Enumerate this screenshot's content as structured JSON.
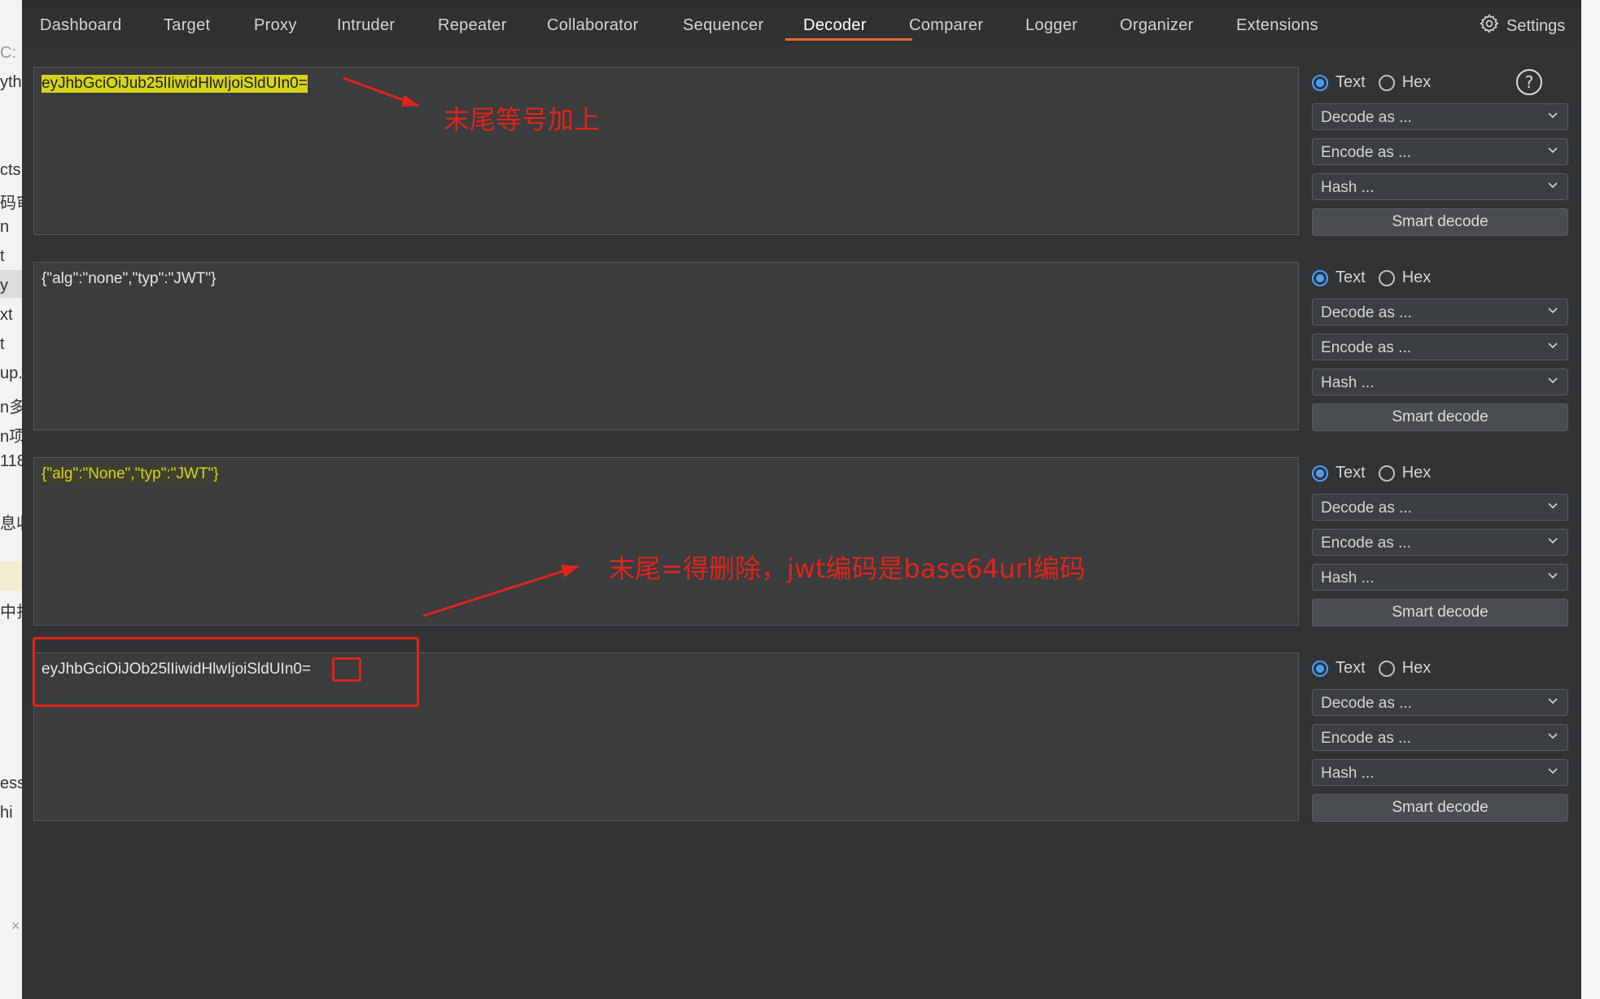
{
  "left_strip": {
    "fragments": [
      "C:",
      "ythe",
      "cts",
      "码审",
      "n",
      "t",
      "y",
      "xt",
      "t",
      "up.",
      "n多",
      "n项",
      "118",
      "息收",
      "中打",
      "ess",
      "hi",
      "×"
    ]
  },
  "tabs": [
    "Dashboard",
    "Target",
    "Proxy",
    "Intruder",
    "Repeater",
    "Collaborator",
    "Sequencer",
    "Decoder",
    "Comparer",
    "Logger",
    "Organizer",
    "Extensions"
  ],
  "active_tab": "Decoder",
  "settings_label": "Settings",
  "panels": [
    {
      "text": "eyJhbGciOiJub25lIiwidHlwIjoiSldUIn0=",
      "radio_text": "Text",
      "radio_hex": "Hex",
      "selected": "Text",
      "decode": "Decode as ...",
      "encode": "Encode as ...",
      "hash": "Hash ...",
      "smart": "Smart decode"
    },
    {
      "text": "{\"alg\":\"none\",\"typ\":\"JWT\"}",
      "radio_text": "Text",
      "radio_hex": "Hex",
      "selected": "Text",
      "decode": "Decode as ...",
      "encode": "Encode as ...",
      "hash": "Hash ...",
      "smart": "Smart decode"
    },
    {
      "text": "{\"alg\":\"None\",\"typ\":\"JWT\"}",
      "radio_text": "Text",
      "radio_hex": "Hex",
      "selected": "Text",
      "decode": "Decode as ...",
      "encode": "Encode as ...",
      "hash": "Hash ...",
      "smart": "Smart decode"
    },
    {
      "text": "eyJhbGciOiJOb25lIiwidHlwIjoiSldUIn0",
      "text_suffix": "=",
      "radio_text": "Text",
      "radio_hex": "Hex",
      "selected": "Text",
      "decode": "Decode as ...",
      "encode": "Encode as ...",
      "hash": "Hash ...",
      "smart": "Smart decode"
    }
  ],
  "annotations": {
    "note1": "末尾等号加上",
    "note2": "末尾=得删除，jwt编码是base64url编码"
  },
  "colors": {
    "accent": "#e8692e",
    "radio": "#4a9eff",
    "highlight": "#d6d41a",
    "annotation": "#e0251b"
  }
}
